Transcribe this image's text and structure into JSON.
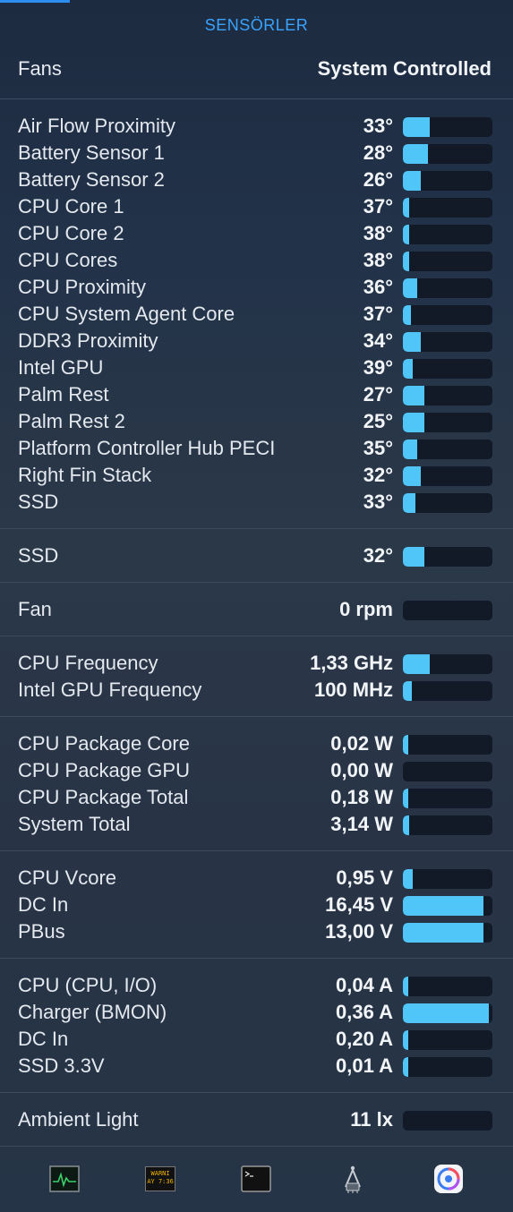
{
  "header": {
    "title": "SENSÖRLER"
  },
  "fans": {
    "label": "Fans",
    "value": "System Controlled"
  },
  "sections": [
    {
      "rows": [
        {
          "name": "Air Flow Proximity",
          "value": "33°",
          "level": 0.3
        },
        {
          "name": "Battery Sensor 1",
          "value": "28°",
          "level": 0.28
        },
        {
          "name": "Battery Sensor 2",
          "value": "26°",
          "level": 0.2
        },
        {
          "name": "CPU Core 1",
          "value": "37°",
          "level": 0.07
        },
        {
          "name": "CPU Core 2",
          "value": "38°",
          "level": 0.07
        },
        {
          "name": "CPU Cores",
          "value": "38°",
          "level": 0.07
        },
        {
          "name": "CPU Proximity",
          "value": "36°",
          "level": 0.16
        },
        {
          "name": "CPU System Agent Core",
          "value": "37°",
          "level": 0.09
        },
        {
          "name": "DDR3 Proximity",
          "value": "34°",
          "level": 0.2
        },
        {
          "name": "Intel GPU",
          "value": "39°",
          "level": 0.11
        },
        {
          "name": "Palm Rest",
          "value": "27°",
          "level": 0.24
        },
        {
          "name": "Palm Rest 2",
          "value": "25°",
          "level": 0.24
        },
        {
          "name": "Platform Controller Hub PECI",
          "value": "35°",
          "level": 0.16
        },
        {
          "name": "Right Fin Stack",
          "value": "32°",
          "level": 0.2
        },
        {
          "name": "SSD",
          "value": "33°",
          "level": 0.14
        }
      ]
    },
    {
      "rows": [
        {
          "name": "SSD",
          "value": "32°",
          "level": 0.24
        }
      ]
    },
    {
      "rows": [
        {
          "name": "Fan",
          "value": "0 rpm",
          "level": 0.0
        }
      ]
    },
    {
      "rows": [
        {
          "name": "CPU Frequency",
          "value": "1,33 GHz",
          "level": 0.3
        },
        {
          "name": "Intel GPU Frequency",
          "value": "100 MHz",
          "level": 0.1
        }
      ]
    },
    {
      "rows": [
        {
          "name": "CPU Package Core",
          "value": "0,02 W",
          "level": 0.03
        },
        {
          "name": "CPU Package GPU",
          "value": "0,00 W",
          "level": 0.0
        },
        {
          "name": "CPU Package Total",
          "value": "0,18 W",
          "level": 0.03
        },
        {
          "name": "System Total",
          "value": "3,14 W",
          "level": 0.07
        }
      ]
    },
    {
      "rows": [
        {
          "name": "CPU Vcore",
          "value": "0,95 V",
          "level": 0.11
        },
        {
          "name": "DC In",
          "value": "16,45 V",
          "level": 0.9
        },
        {
          "name": "PBus",
          "value": "13,00 V",
          "level": 0.9
        }
      ]
    },
    {
      "rows": [
        {
          "name": "CPU (CPU, I/O)",
          "value": "0,04 A",
          "level": 0.03
        },
        {
          "name": "Charger (BMON)",
          "value": "0,36 A",
          "level": 0.96
        },
        {
          "name": "DC In",
          "value": "0,20 A",
          "level": 0.03
        },
        {
          "name": "SSD 3.3V",
          "value": "0,01 A",
          "level": 0.03
        }
      ]
    },
    {
      "rows": [
        {
          "name": "Ambient Light",
          "value": "11 lx",
          "level": 0.0
        }
      ]
    }
  ],
  "footer": {
    "icons": [
      "activity-monitor-icon",
      "console-icon",
      "terminal-icon",
      "system-information-icon",
      "istat-icon"
    ],
    "console_text": [
      "WARNI",
      "AY 7:36"
    ]
  },
  "colors": {
    "accent": "#3aa3ff",
    "bar_fill": "#4fc6f7",
    "bar_track": "#111a26"
  }
}
